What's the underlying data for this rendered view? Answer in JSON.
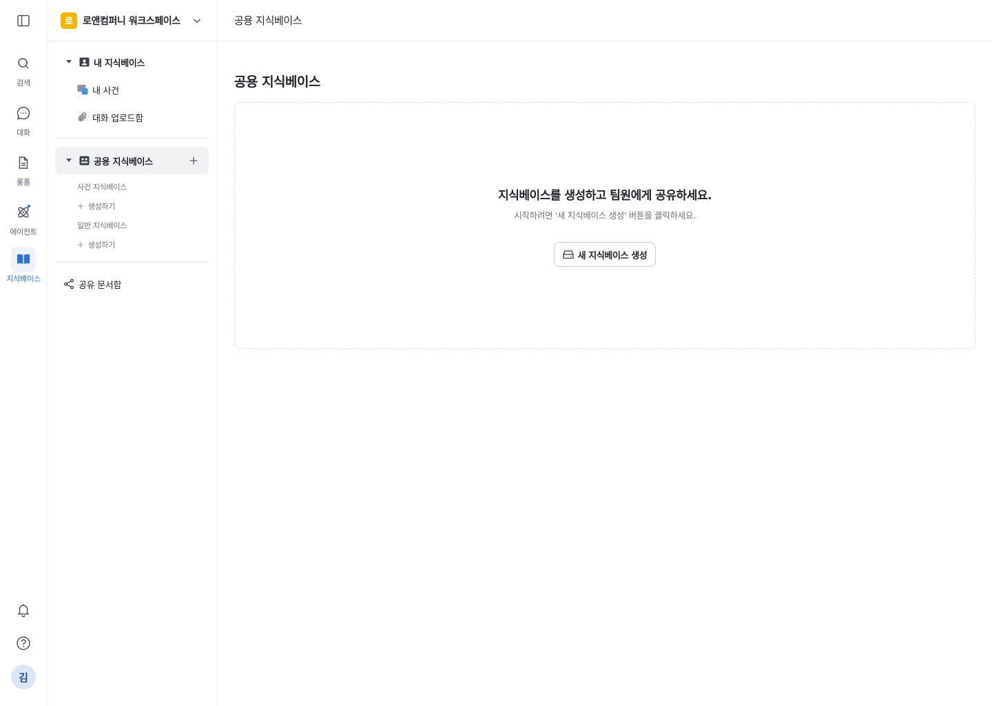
{
  "rail": {
    "items": [
      {
        "label": "검색",
        "icon": "search-icon"
      },
      {
        "label": "대화",
        "icon": "chat-icon"
      },
      {
        "label": "롱폼",
        "icon": "document-icon"
      },
      {
        "label": "에이전트",
        "icon": "atom-icon"
      },
      {
        "label": "지식베이스",
        "icon": "book-icon",
        "active": true
      }
    ],
    "avatar_initial": "김"
  },
  "sidebar": {
    "workspace": {
      "logo_initial": "로",
      "name": "로앤컴퍼니 워크스페이스"
    },
    "my_kb": {
      "label": "내 지식베이스",
      "children": [
        {
          "label": "내 사건"
        },
        {
          "label": "대화 업로드함"
        }
      ]
    },
    "shared_kb": {
      "label": "공용 지식베이스",
      "sections": [
        {
          "label": "사건 지식베이스",
          "add_label": "생성하기"
        },
        {
          "label": "일반 지식베이스",
          "add_label": "생성하기"
        }
      ]
    },
    "shared_docs_label": "공유 문서함"
  },
  "main": {
    "topbar_title": "공용 지식베이스",
    "page_title": "공용 지식베이스",
    "empty_state": {
      "title": "지식베이스를 생성하고 팀원에게 공유하세요.",
      "description": "시작하려면 '새 지식베이스 생성' 버튼을 클릭하세요.",
      "button_label": "새 지식베이스 생성"
    }
  },
  "colors": {
    "accent": "#2f6fd6",
    "workspace_logo": "#f5b400",
    "selected_bg": "#f1f2f4",
    "avatar_bg": "#dbe6f6"
  }
}
